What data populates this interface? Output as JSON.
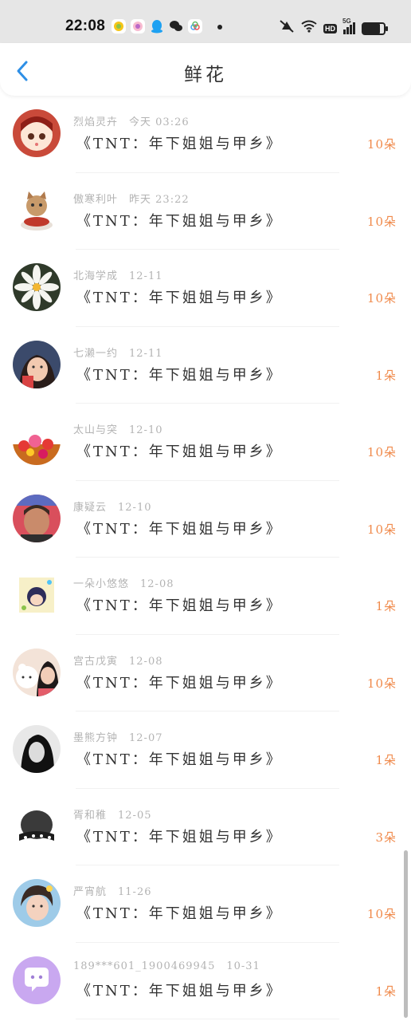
{
  "status_bar": {
    "time": "22:08",
    "app_icons": [
      "app-icon-1",
      "app-icon-2",
      "qq-icon",
      "wechat-icon",
      "app-icon-5"
    ],
    "network_label": "HD",
    "signal_label": "5G",
    "battery_percent": 80
  },
  "header": {
    "title": "鲜花",
    "back_icon": "chevron-left-icon"
  },
  "colors": {
    "accent": "#2e8fe6",
    "count": "#f08a4b",
    "meta": "#b3b3b3"
  },
  "list": [
    {
      "name": "烈焰灵卉",
      "time": "今天 03:26",
      "message": "《TNT：年下姐姐与甲乡》",
      "count": "10朵"
    },
    {
      "name": "傲寒利叶",
      "time": "昨天 23:22",
      "message": "《TNT：年下姐姐与甲乡》",
      "count": "10朵"
    },
    {
      "name": "北海学成",
      "time": "12-11",
      "message": "《TNT：年下姐姐与甲乡》",
      "count": "10朵"
    },
    {
      "name": "七濑一约",
      "time": "12-11",
      "message": "《TNT：年下姐姐与甲乡》",
      "count": "1朵"
    },
    {
      "name": "太山与突",
      "time": "12-10",
      "message": "《TNT：年下姐姐与甲乡》",
      "count": "10朵"
    },
    {
      "name": "康疑云",
      "time": "12-10",
      "message": "《TNT：年下姐姐与甲乡》",
      "count": "10朵"
    },
    {
      "name": "一朵小悠悠",
      "time": "12-08",
      "message": "《TNT：年下姐姐与甲乡》",
      "count": "1朵"
    },
    {
      "name": "宫古戊寅",
      "time": "12-08",
      "message": "《TNT：年下姐姐与甲乡》",
      "count": "10朵"
    },
    {
      "name": "墨熊方钟",
      "time": "12-07",
      "message": "《TNT：年下姐姐与甲乡》",
      "count": "1朵"
    },
    {
      "name": "胥和稚",
      "time": "12-05",
      "message": "《TNT：年下姐姐与甲乡》",
      "count": "3朵"
    },
    {
      "name": "严宵航",
      "time": "11-26",
      "message": "《TNT：年下姐姐与甲乡》",
      "count": "10朵"
    },
    {
      "name": "189***601_1900469945",
      "time": "10-31",
      "message": "《TNT：年下姐姐与甲乡》",
      "count": "1朵"
    }
  ]
}
